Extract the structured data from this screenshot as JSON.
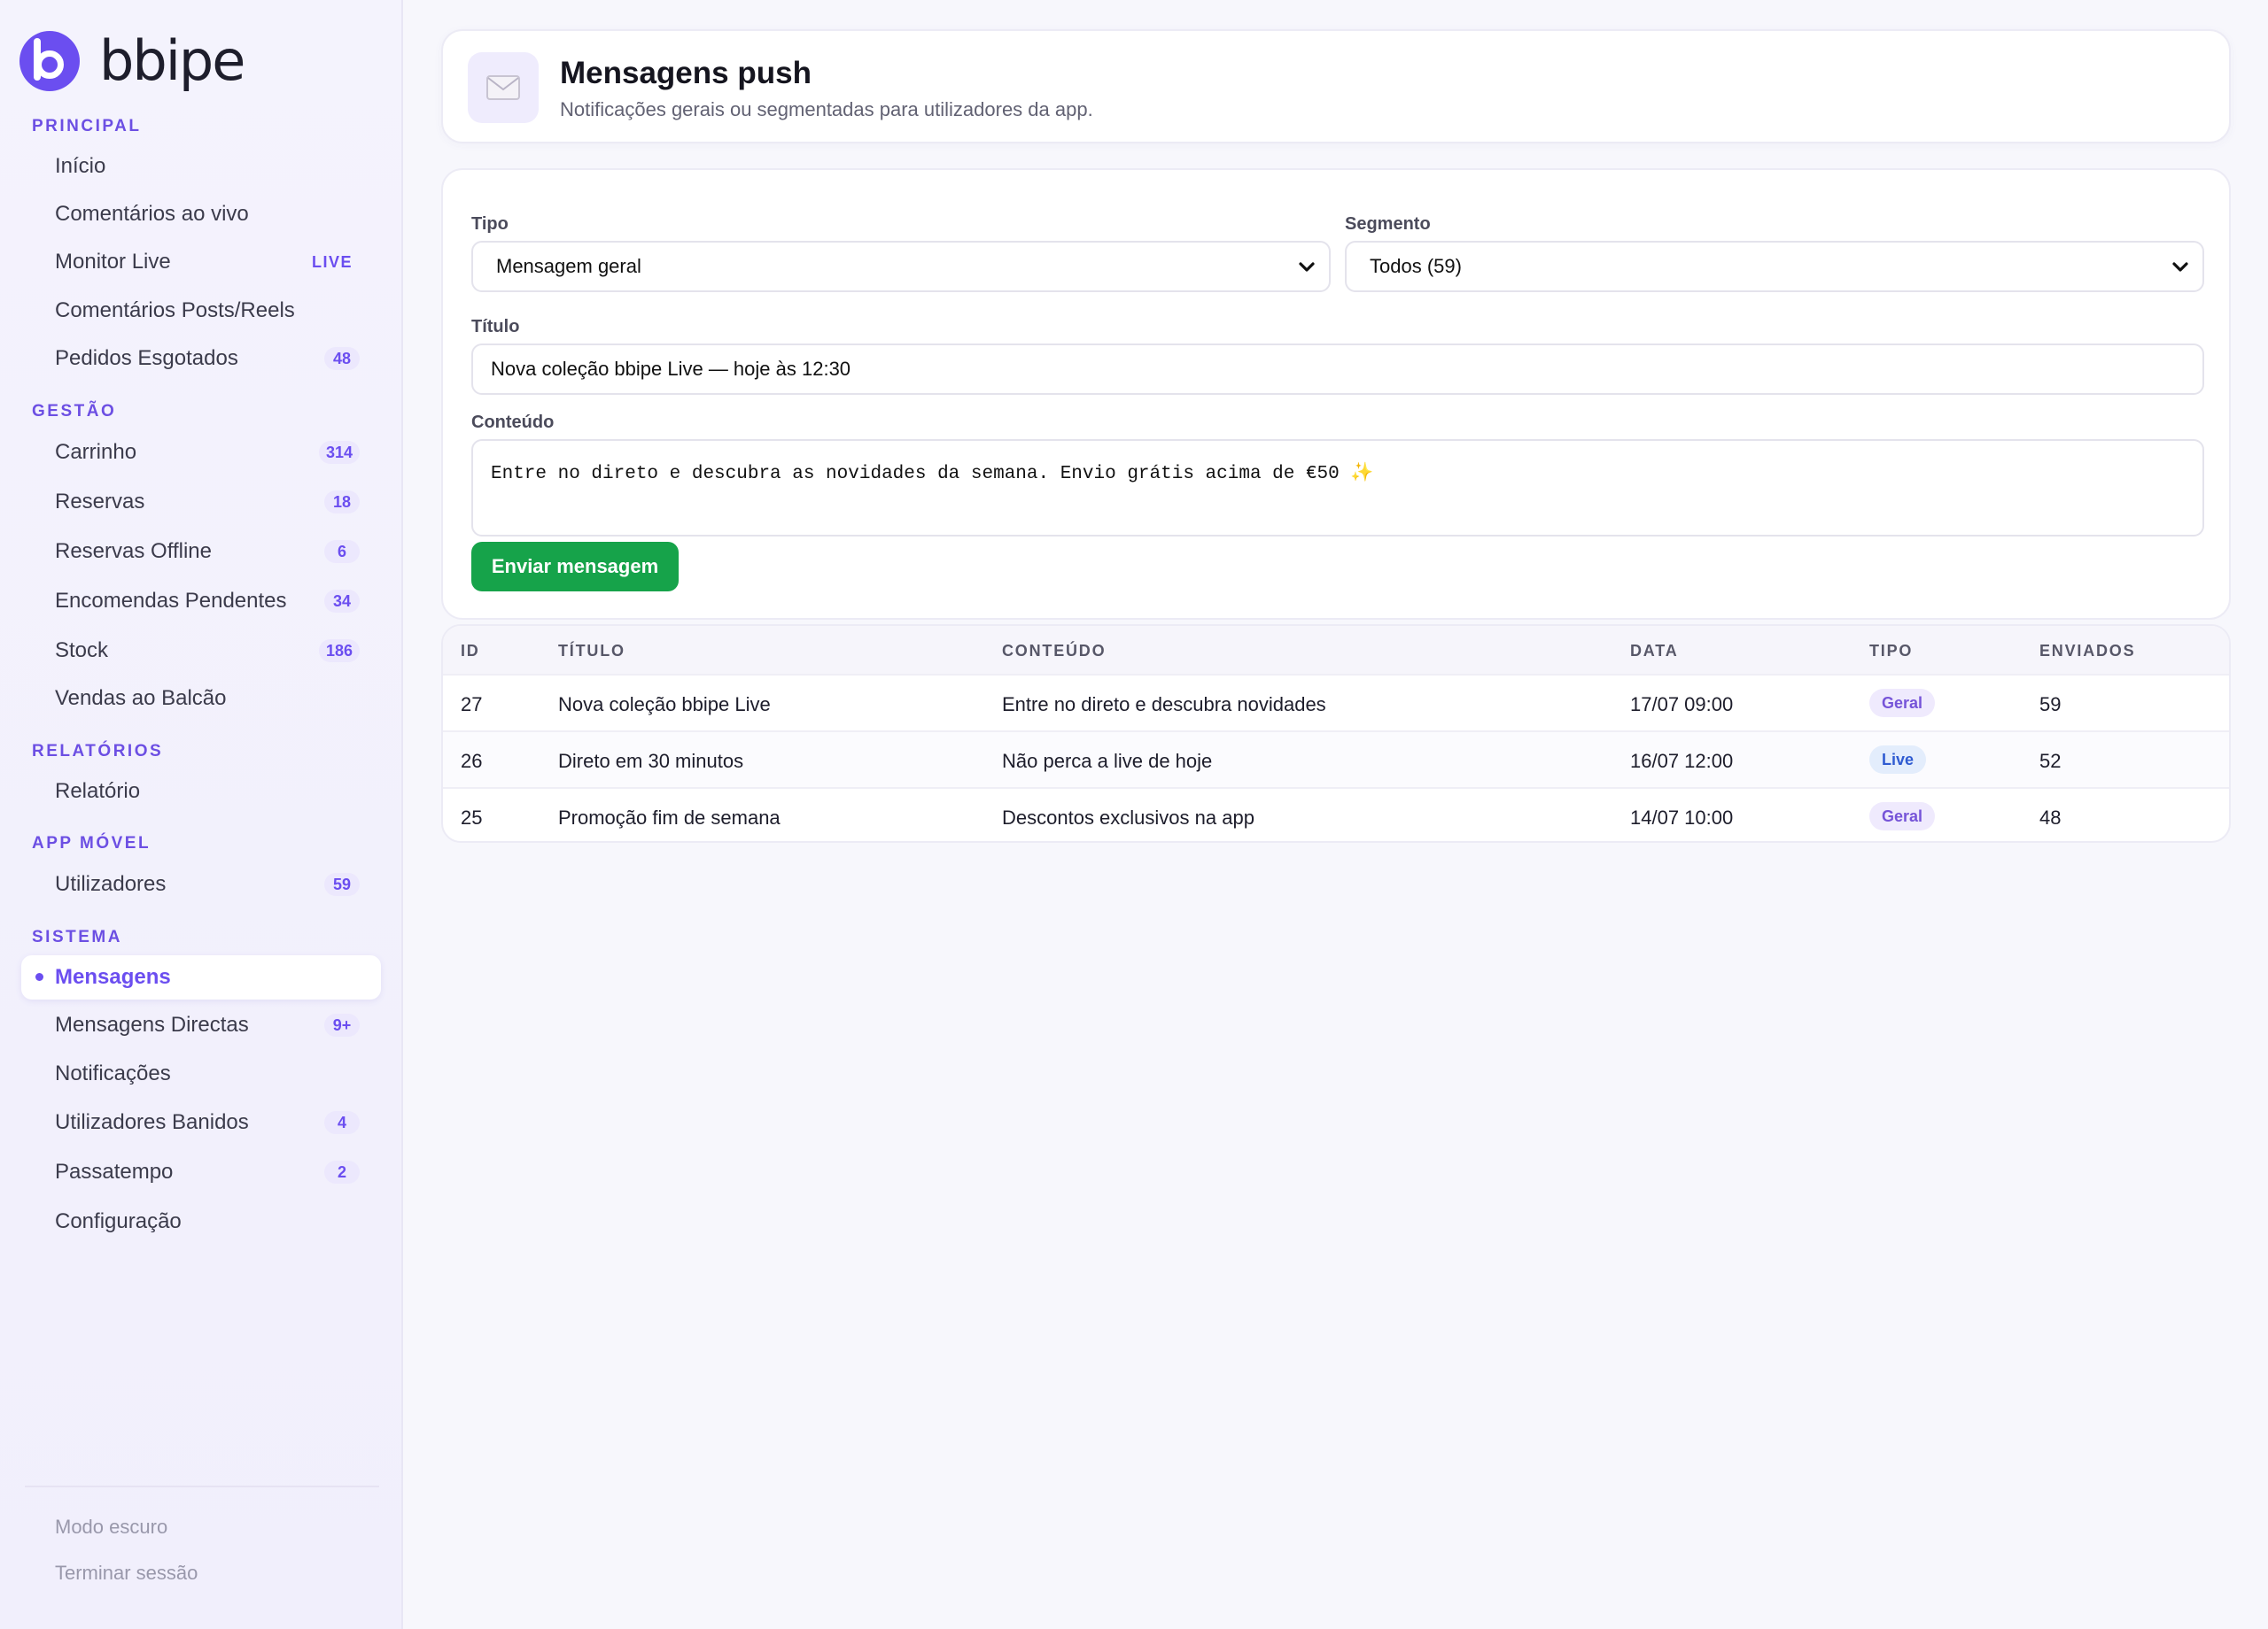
{
  "brand": {
    "name": "bbipe",
    "accent": "#6b4ef0"
  },
  "sidebar": {
    "sections": [
      {
        "title": "PRINCIPAL",
        "items": [
          {
            "label": "Início",
            "badge": ""
          },
          {
            "label": "Comentários ao vivo",
            "badge": ""
          },
          {
            "label": "Monitor Live",
            "badge": "LIVE"
          },
          {
            "label": "Comentários Posts/Reels",
            "badge": ""
          },
          {
            "label": "Pedidos Esgotados",
            "badge": "48"
          }
        ]
      },
      {
        "title": "GESTÃO",
        "items": [
          {
            "label": "Carrinho",
            "badge": "314"
          },
          {
            "label": "Reservas",
            "badge": "18"
          },
          {
            "label": "Reservas Offline",
            "badge": "6"
          },
          {
            "label": "Encomendas Pendentes",
            "badge": "34"
          },
          {
            "label": "Stock",
            "badge": "186"
          },
          {
            "label": "Vendas ao Balcão",
            "badge": ""
          }
        ]
      },
      {
        "title": "RELATÓRIOS",
        "items": [
          {
            "label": "Relatório",
            "badge": ""
          }
        ]
      },
      {
        "title": "APP MÓVEL",
        "items": [
          {
            "label": "Utilizadores",
            "badge": "59"
          }
        ]
      },
      {
        "title": "SISTEMA",
        "items": [
          {
            "label": "Mensagens",
            "badge": "",
            "active": true
          },
          {
            "label": "Mensagens Directas",
            "badge": "9+"
          },
          {
            "label": "Notificações",
            "badge": ""
          },
          {
            "label": "Utilizadores Banidos",
            "badge": "4"
          },
          {
            "label": "Passatempo",
            "badge": "2"
          },
          {
            "label": "Configuração",
            "badge": ""
          }
        ]
      }
    ],
    "footer": {
      "dark_mode": "Modo escuro",
      "logout": "Terminar sessão"
    }
  },
  "header": {
    "icon": "envelope-icon",
    "title": "Mensagens push",
    "subtitle": "Notificações gerais ou segmentadas para utilizadores da app."
  },
  "form": {
    "tipo_label": "Tipo",
    "tipo_value": "Mensagem geral",
    "segmento_label": "Segmento",
    "segmento_value": "Todos (59)",
    "titulo_label": "Título",
    "titulo_value": "Nova coleção bbipe Live — hoje às 12:30",
    "conteudo_label": "Conteúdo",
    "conteudo_value": "Entre no direto e descubra as novidades da semana. Envio grátis acima de €50 ✨",
    "send_label": "Enviar mensagem",
    "send_color": "#16a34a"
  },
  "table": {
    "headers": {
      "id": "ID",
      "titulo": "TÍTULO",
      "conteudo": "CONTEÚDO",
      "data": "DATA",
      "tipo": "TIPO",
      "enviados": "ENVIADOS"
    },
    "rows": [
      {
        "id": "27",
        "titulo": "Nova coleção bbipe Live",
        "conteudo": "Entre no direto e descubra novidades",
        "data": "17/07 09:00",
        "tipo": "Geral",
        "enviados": "59"
      },
      {
        "id": "26",
        "titulo": "Direto em 30 minutos",
        "conteudo": "Não perca a live de hoje",
        "data": "16/07 12:00",
        "tipo": "Live",
        "enviados": "52"
      },
      {
        "id": "25",
        "titulo": "Promoção fim de semana",
        "conteudo": "Descontos exclusivos na app",
        "data": "14/07 10:00",
        "tipo": "Geral",
        "enviados": "48"
      }
    ]
  }
}
